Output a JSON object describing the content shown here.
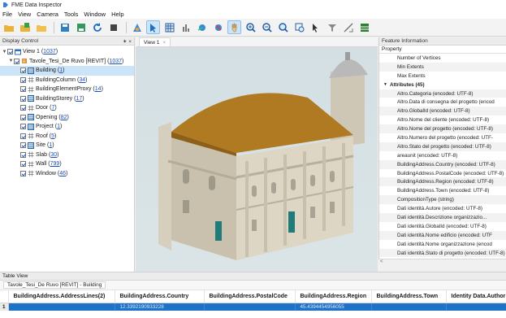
{
  "window": {
    "title": "FME Data Inspector"
  },
  "menu": [
    "File",
    "View",
    "Camera",
    "Tools",
    "Window",
    "Help"
  ],
  "toolbar": {
    "icons": [
      "open-folder-icon",
      "open-dataset-icon",
      "folder-icon",
      "save-icon",
      "export-icon",
      "refresh-icon",
      "stop-icon",
      "background-map-icon",
      "select-icon",
      "table-icon",
      "chart-icon",
      "orbit-icon",
      "pan-icon",
      "hand-icon",
      "zoom-in-icon",
      "zoom-out-icon",
      "zoom-extents-icon",
      "zoom-select-icon",
      "select-pointer-icon",
      "filter-icon",
      "measure-icon",
      "grid-icon"
    ]
  },
  "display_control": {
    "header": "Display Control",
    "pin": "✶ ×",
    "view_root": {
      "label": "View 1",
      "count": "1037"
    },
    "dataset": {
      "label": "Tavole_Tesi_De Ruvo [REVIT]",
      "count": "1037"
    },
    "layers": [
      {
        "label": "Building",
        "count": "1"
      },
      {
        "label": "BuildingColumn",
        "count": "34"
      },
      {
        "label": "BuildingElementProxy",
        "count": "14"
      },
      {
        "label": "BuildingStorey",
        "count": "17"
      },
      {
        "label": "Door",
        "count": "7"
      },
      {
        "label": "Opening",
        "count": "82"
      },
      {
        "label": "Project",
        "count": "1"
      },
      {
        "label": "Roof",
        "count": "5"
      },
      {
        "label": "Site",
        "count": "1"
      },
      {
        "label": "Slab",
        "count": "30"
      },
      {
        "label": "Wall",
        "count": "799"
      },
      {
        "label": "Window",
        "count": "46"
      }
    ]
  },
  "view": {
    "tab_label": "View 1",
    "tab_close": "×"
  },
  "feature_info": {
    "header": "Feature Information",
    "column": "Property",
    "rows": [
      "Number of Vertices",
      "Min Extents",
      "Max Extents"
    ],
    "group": "Attributes (45)",
    "attributes": [
      "Altro.Categoria (encoded: UTF-8)",
      "Altro.Data di consegna del progetto (encod",
      "Altro.GlobalId (encoded: UTF-8)",
      "Altro.Nome del cliente (encoded: UTF-8)",
      "Altro.Nome del progetto (encoded: UTF-8)",
      "Altro.Numero del progetto (encoded: UTF-",
      "Altro.Stato del progetto (encoded: UTF-8)",
      "areaunit (encoded: UTF-8)",
      "BuildingAddress.Country (encoded: UTF-8)",
      "BuildingAddress.PostalCode (encoded: UTF-8)",
      "BuildingAddress.Region (encoded: UTF-8)",
      "BuildingAddress.Town (encoded: UTF-8)",
      "CompositionType (string)",
      "Dati identità.Autore (encoded: UTF-8)",
      "Dati identità.Descrizione organizzazio...",
      "Dati identità.GlobalId (encoded: UTF-8)",
      "Dati identità.Nome edificio (encoded: UTF",
      "Dati identità.Nome organizzazione (encod",
      "Dati identità.Stato di progetto (encoded: UTF-8)"
    ],
    "scroll_left": "<"
  },
  "table_view": {
    "header": "Table View",
    "tab": "Tavole_Tesi_De Ruvo [REVIT] - Building",
    "columns": [
      "BuildingAddress.AddressLines(2)",
      "BuildingAddress.Country",
      "BuildingAddress.PostalCode",
      "BuildingAddress.Region",
      "BuildingAddress.Town",
      "Identity Data.Author"
    ],
    "rows": [
      {
        "index": "1",
        "cells": [
          "",
          "12.3392190933228",
          "",
          "45.4394454956055",
          "",
          ""
        ]
      }
    ]
  },
  "colors": {
    "selection": "#cce4f7",
    "table_selected_row": "#1e72c8",
    "roof": "#b07a22",
    "facade": "#d8d1c0",
    "dome": "#bdbdbd",
    "door": "#1f7c78"
  }
}
